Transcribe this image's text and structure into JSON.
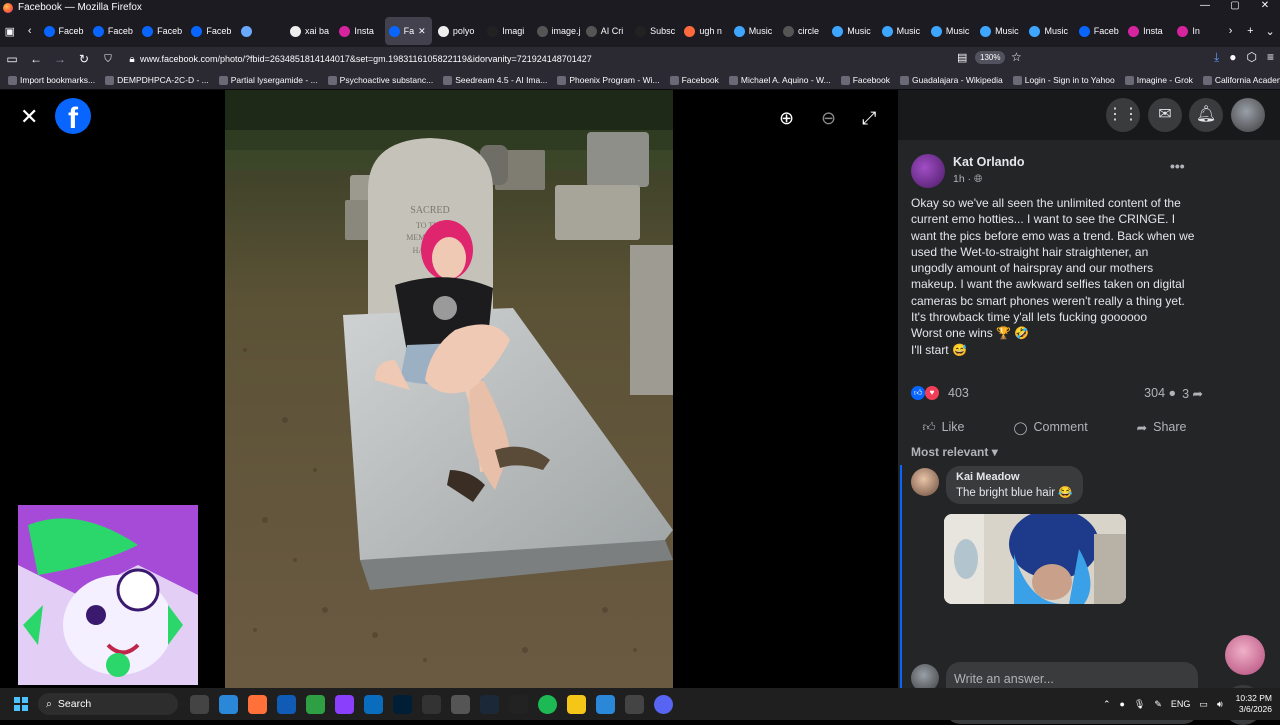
{
  "window": {
    "title": "Facebook — Mozilla Firefox",
    "controls": [
      "—",
      "▢",
      "✕"
    ]
  },
  "tabs": [
    {
      "label": "Faceb",
      "color": "#0866ff"
    },
    {
      "label": "Faceb",
      "color": "#0866ff"
    },
    {
      "label": "Faceb",
      "color": "#0866ff"
    },
    {
      "label": "Faceb",
      "color": "#0866ff"
    },
    {
      "label": "",
      "color": "#6aa9ff"
    },
    {
      "label": "xai ba",
      "color": "#eeeeee"
    },
    {
      "label": "Insta",
      "color": "#d6249f"
    },
    {
      "label": "Fa",
      "color": "#0866ff",
      "active": true
    },
    {
      "label": "polyo",
      "color": "#eeeeee"
    },
    {
      "label": "Imagi",
      "color": "#222222"
    },
    {
      "label": "image.jpg",
      "color": "#555555"
    },
    {
      "label": "AI Cri",
      "color": "#555555"
    },
    {
      "label": "Subsc",
      "color": "#222222"
    },
    {
      "label": "ugh n",
      "color": "#ff6b3d"
    },
    {
      "label": "Music",
      "color": "#3ea6ff"
    },
    {
      "label": "circle",
      "color": "#555555"
    },
    {
      "label": "Music",
      "color": "#3ea6ff"
    },
    {
      "label": "Music",
      "color": "#3ea6ff"
    },
    {
      "label": "Music",
      "color": "#3ea6ff"
    },
    {
      "label": "Music",
      "color": "#3ea6ff"
    },
    {
      "label": "Music",
      "color": "#3ea6ff"
    },
    {
      "label": "Faceb",
      "color": "#0866ff"
    },
    {
      "label": "Insta",
      "color": "#d6249f"
    },
    {
      "label": "In",
      "color": "#d6249f"
    }
  ],
  "navbar": {
    "url": "www.facebook.com/photo/?fbid=2634851814144017&set=gm.1983116105822119&idorvanity=721924148701427",
    "zoom": "130%"
  },
  "bookmarks": [
    "Import bookmarks...",
    "DEMPDHPCA-2C-D - ...",
    "Partial lysergamide - ...",
    "Psychoactive substanc...",
    "Seedream 4.5 - AI Ima...",
    "Phoenix Program - Wi...",
    "Facebook",
    "Michael A. Aquino - W...",
    "Facebook",
    "Guadalajara - Wikipedia",
    "Login - Sign in to Yahoo",
    "Imagine - Grok",
    "California Academy of..."
  ],
  "photo": {
    "alt": "Woman with pink hair lying on a marble grave slab in a cemetery",
    "headstone_text": [
      "SACRED",
      "TO THE",
      "MEMORY OF",
      "HARRIET"
    ]
  },
  "post": {
    "author": "Kat Orlando",
    "time": "1h ·",
    "text_lines": [
      "Okay so we've all seen the unlimited content of the",
      "current emo hotties... I want to see the CRINGE. I",
      "want the pics before emo was a trend. Back when we",
      "used the Wet-to-straight hair straightener, an",
      "ungodly amount of hairspray and our mothers",
      "makeup. I want the awkward selfies taken on digital",
      "cameras bc smart phones weren't really a thing yet.",
      "It's throwback time y'all lets fucking goooooo",
      "Worst one wins 🏆 🤣",
      "I'll start 😅"
    ],
    "reactions_count": "403",
    "comments_count": "304",
    "shares_count": "3",
    "actions": {
      "like": "Like",
      "comment": "Comment",
      "share": "Share"
    },
    "sort": "Most relevant"
  },
  "comment": {
    "author": "Kai Meadow",
    "text": "The bright blue hair 😂"
  },
  "reply": {
    "placeholder": "Write an answer..."
  },
  "taskbar": {
    "search": "Search",
    "lang": "ENG",
    "time": "10:32 PM",
    "date": "3/6/2026"
  },
  "colors": {
    "facebook_blue": "#0866ff",
    "panel_bg": "#242526",
    "bubble_bg": "#3a3b3c"
  }
}
